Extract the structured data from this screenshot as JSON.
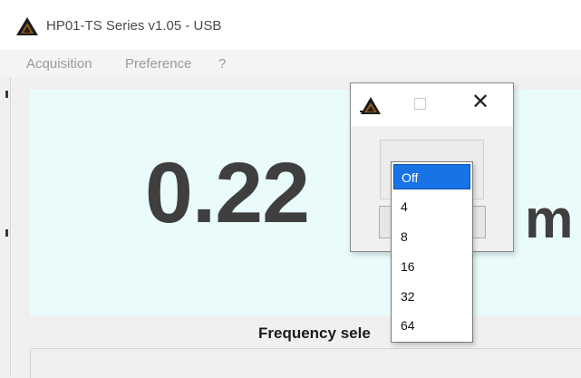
{
  "window": {
    "title": "HP01-TS Series v1.05 - USB"
  },
  "menu": {
    "items": [
      "Acquisition",
      "Preference",
      "?"
    ]
  },
  "display": {
    "value": "0.22",
    "unit": "m"
  },
  "frequency": {
    "label": "Frequency sele"
  },
  "dialog": {
    "close_glyph": "✕"
  },
  "dropdown": {
    "selected": "Off",
    "options": [
      "Off",
      "4",
      "8",
      "16",
      "32",
      "64"
    ]
  },
  "colors": {
    "display_bg": "#e9fcfb",
    "selection": "#1874e6",
    "logo": "#5a3a14"
  }
}
